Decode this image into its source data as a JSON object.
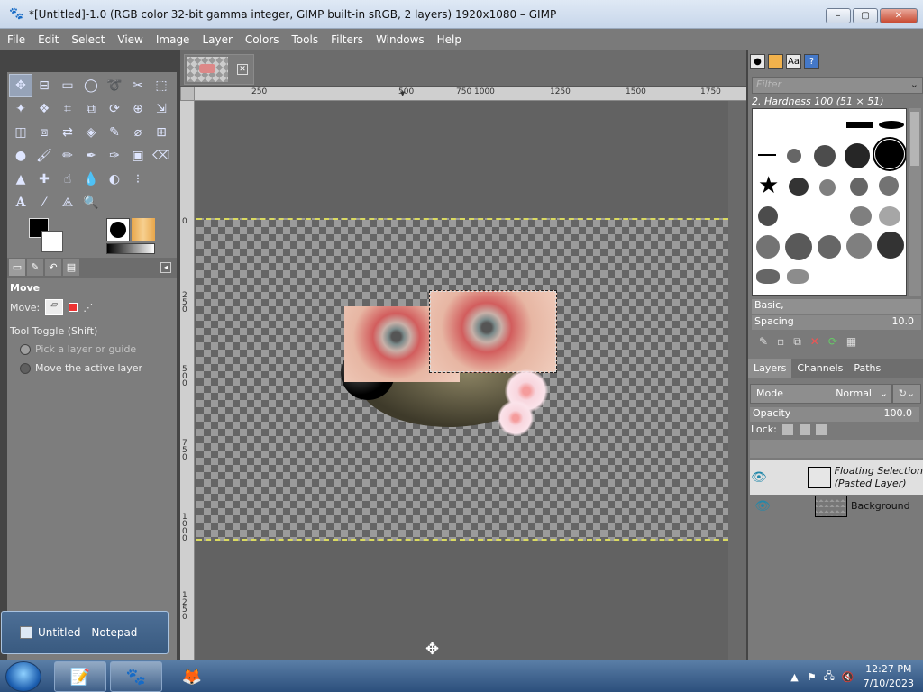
{
  "window": {
    "title": "*[Untitled]-1.0 (RGB color 32-bit gamma integer, GIMP built-in sRGB, 2 layers) 1920x1080 – GIMP",
    "min_label": "–",
    "max_label": "▢",
    "close_label": "✕"
  },
  "menu": [
    "File",
    "Edit",
    "Select",
    "View",
    "Image",
    "Layer",
    "Colors",
    "Tools",
    "Filters",
    "Windows",
    "Help"
  ],
  "tool_options": {
    "title": "Move",
    "move_label": "Move:",
    "tool_toggle": "Tool Toggle  (Shift)",
    "option_pick": "Pick a layer or guide",
    "option_move": "Move the active layer"
  },
  "rulers": {
    "h_ticks": [
      "250",
      "500",
      "750",
      "1000",
      "1250",
      "1500",
      "1750"
    ],
    "v_ticks": [
      "0",
      "250",
      "500",
      "750",
      "1000",
      "1250"
    ]
  },
  "brushes": {
    "filter_placeholder": "Filter",
    "current": "2. Hardness 100 (51 × 51)",
    "preset": "Basic,",
    "spacing_label": "Spacing",
    "spacing_value": "10.0"
  },
  "layers_panel": {
    "tabs": [
      "Layers",
      "Channels",
      "Paths"
    ],
    "mode_label": "Mode",
    "mode_value": "Normal",
    "opacity_label": "Opacity",
    "opacity_value": "100.0",
    "lock_label": "Lock:",
    "layers": [
      {
        "name": "Floating Selection\n(Pasted Layer)"
      },
      {
        "name": "Background"
      }
    ]
  },
  "taskbar": {
    "notepad_popup": "Untitled - Notepad",
    "time": "12:27 PM",
    "date": "7/10/2023"
  }
}
